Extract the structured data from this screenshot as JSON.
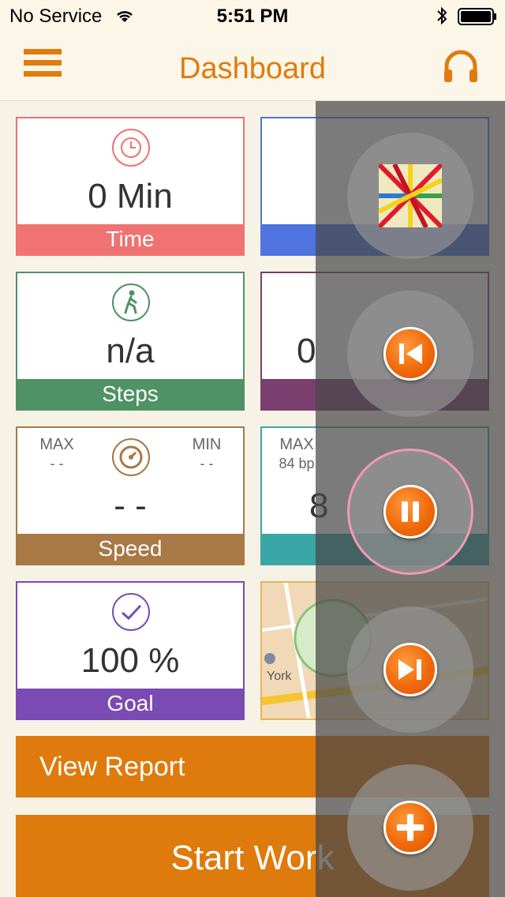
{
  "status_bar": {
    "carrier": "No Service",
    "time": "5:51 PM"
  },
  "nav": {
    "title": "Dashboard"
  },
  "cards": {
    "time": {
      "value": "0 Min",
      "label": "Time",
      "color": "#f07272"
    },
    "steps": {
      "value": "n/a",
      "label": "Steps",
      "color": "#4f9265"
    },
    "steps_right_value": "0",
    "speed": {
      "label": "Speed",
      "value": "- -",
      "color": "#a87845",
      "max_label": "MAX",
      "max_value": "- -",
      "min_label": "MIN",
      "min_value": "- -"
    },
    "heart": {
      "max_label": "MAX",
      "max_value": "84 bp",
      "value": "8",
      "color": "#3ba6a6"
    },
    "goal": {
      "value": "100 %",
      "label": "Goal",
      "color": "#7a4bb3"
    },
    "map_label": "York"
  },
  "buttons": {
    "view_report": "View Report",
    "start_workout": "Start Work"
  },
  "music_controls": [
    "album-art",
    "previous",
    "pause",
    "next",
    "add"
  ]
}
